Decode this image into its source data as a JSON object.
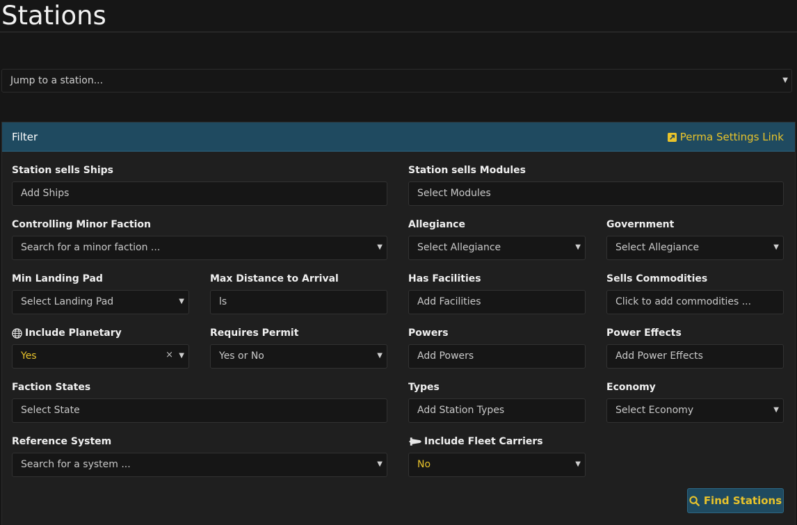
{
  "page_title": "Stations",
  "jump": {
    "placeholder": "Jump to a station..."
  },
  "filter": {
    "title": "Filter",
    "perma_link": "Perma Settings Link",
    "find_button": "Find Stations",
    "fields": {
      "ships": {
        "label": "Station sells Ships",
        "placeholder": "Add Ships"
      },
      "modules": {
        "label": "Station sells Modules",
        "placeholder": "Select Modules"
      },
      "minor_faction": {
        "label": "Controlling Minor Faction",
        "placeholder": "Search for a minor faction ..."
      },
      "allegiance": {
        "label": "Allegiance",
        "placeholder": "Select Allegiance"
      },
      "government": {
        "label": "Government",
        "placeholder": "Select Allegiance"
      },
      "landing_pad": {
        "label": "Min Landing Pad",
        "placeholder": "Select Landing Pad"
      },
      "max_distance": {
        "label": "Max Distance to Arrival",
        "placeholder": "ls"
      },
      "facilities": {
        "label": "Has Facilities",
        "placeholder": "Add Facilities"
      },
      "commodities": {
        "label": "Sells Commodities",
        "placeholder": "Click to add commodities ..."
      },
      "planetary": {
        "label": "Include Planetary",
        "value": "Yes"
      },
      "permit": {
        "label": "Requires Permit",
        "placeholder": "Yes or No"
      },
      "powers": {
        "label": "Powers",
        "placeholder": "Add Powers"
      },
      "power_effects": {
        "label": "Power Effects",
        "placeholder": "Add Power Effects"
      },
      "faction_states": {
        "label": "Faction States",
        "placeholder": "Select State"
      },
      "types": {
        "label": "Types",
        "placeholder": "Add Station Types"
      },
      "economy": {
        "label": "Economy",
        "placeholder": "Select Economy"
      },
      "reference_system": {
        "label": "Reference System",
        "placeholder": "Search for a system ..."
      },
      "fleet_carriers": {
        "label": "Include Fleet Carriers",
        "value": "No"
      }
    }
  },
  "icons": {
    "caret": "▼",
    "clear": "×"
  },
  "colors": {
    "accent": "#e8c32b",
    "panel_header": "#1f4a60",
    "background": "#161616"
  }
}
